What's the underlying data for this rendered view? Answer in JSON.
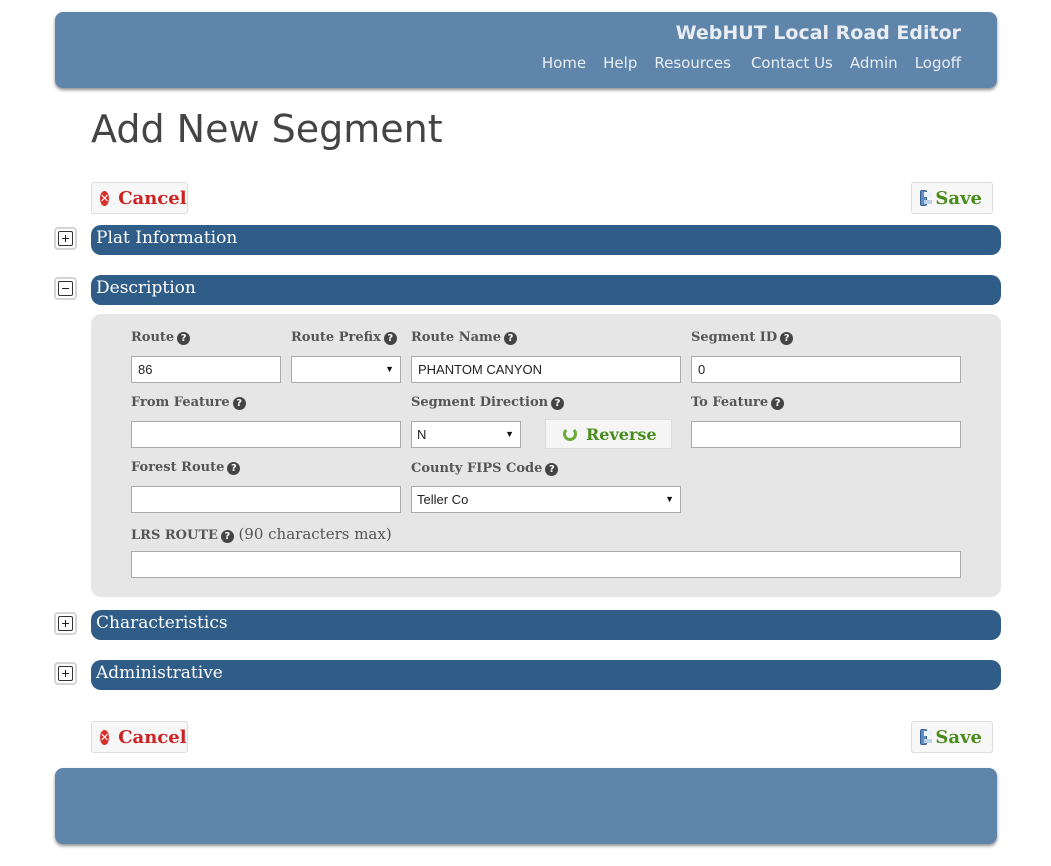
{
  "header": {
    "app_title": "WebHUT Local Road Editor",
    "nav": [
      "Home",
      "Help",
      "Resources",
      "Contact Us",
      "Admin",
      "Logoff"
    ]
  },
  "page_title": "Add New Segment",
  "actions": {
    "cancel_label": "Cancel",
    "save_label": "Save"
  },
  "sections": {
    "plat_information": {
      "label": "Plat Information",
      "expanded": false
    },
    "description": {
      "label": "Description",
      "expanded": true
    },
    "characteristics": {
      "label": "Characteristics",
      "expanded": false
    },
    "administrative": {
      "label": "Administrative",
      "expanded": false
    }
  },
  "description_form": {
    "route": {
      "label": "Route",
      "value": "86"
    },
    "route_prefix": {
      "label": "Route Prefix",
      "value": ""
    },
    "route_name": {
      "label": "Route Name",
      "value": "PHANTOM CANYON"
    },
    "segment_id": {
      "label": "Segment ID",
      "value": "0"
    },
    "from_feature": {
      "label": "From Feature",
      "value": ""
    },
    "segment_direction": {
      "label": "Segment Direction",
      "value": "N"
    },
    "reverse_label": "Reverse",
    "to_feature": {
      "label": "To Feature",
      "value": ""
    },
    "forest_route": {
      "label": "Forest Route",
      "value": ""
    },
    "county_fips": {
      "label": "County FIPS Code",
      "value": "Teller Co"
    },
    "lrs_route": {
      "label": "LRS ROUTE",
      "note": "(90 characters max)",
      "value": ""
    }
  },
  "icons": {
    "help": "question-circle-icon",
    "cancel": "close-circle-icon",
    "save": "floppy-disk-icon",
    "reverse": "refresh-icon",
    "expand": "plus-square-icon",
    "collapse": "minus-square-icon"
  },
  "colors": {
    "header_bg": "#5f86aa",
    "section_bar": "#305d88",
    "panel_bg": "#e6e6e6",
    "cancel_red": "#cc2222",
    "save_green": "#4a8c1c"
  }
}
